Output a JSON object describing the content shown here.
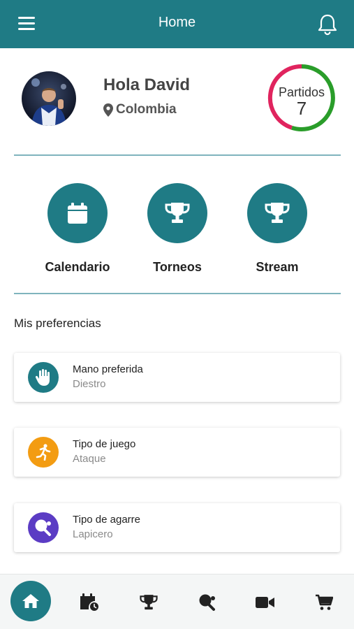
{
  "header": {
    "title": "Home",
    "menu_icon": "hamburger-menu-icon",
    "notification_icon": "bell-icon"
  },
  "profile": {
    "greeting": "Hola David",
    "location": "Colombia",
    "location_icon": "map-pin-icon",
    "stats": {
      "label": "Partidos",
      "value": "7",
      "ring_colors": [
        "#e0245e",
        "#2a9d2a"
      ]
    }
  },
  "actions": [
    {
      "label": "Calendario",
      "icon": "calendar-icon"
    },
    {
      "label": "Torneos",
      "icon": "trophy-icon"
    },
    {
      "label": "Stream",
      "icon": "trophy-icon"
    }
  ],
  "preferences": {
    "title": "Mis preferencias",
    "items": [
      {
        "title": "Mano preferida",
        "value": "Diestro",
        "icon": "hand-icon",
        "color": "#1f7b85"
      },
      {
        "title": "Tipo de juego",
        "value": "Ataque",
        "icon": "running-person-icon",
        "color": "#f39c12"
      },
      {
        "title": "Tipo de agarre",
        "value": "Lapicero",
        "icon": "ping-pong-paddle-icon",
        "color": "#5b3cc4"
      }
    ]
  },
  "bottom_nav": [
    {
      "icon": "home-icon",
      "active": true
    },
    {
      "icon": "calendar-clock-icon"
    },
    {
      "icon": "trophy-icon"
    },
    {
      "icon": "ping-pong-paddle-icon"
    },
    {
      "icon": "video-camera-icon"
    },
    {
      "icon": "shopping-cart-icon"
    }
  ],
  "colors": {
    "primary": "#1f7b85",
    "divider": "#7fb4bd"
  }
}
